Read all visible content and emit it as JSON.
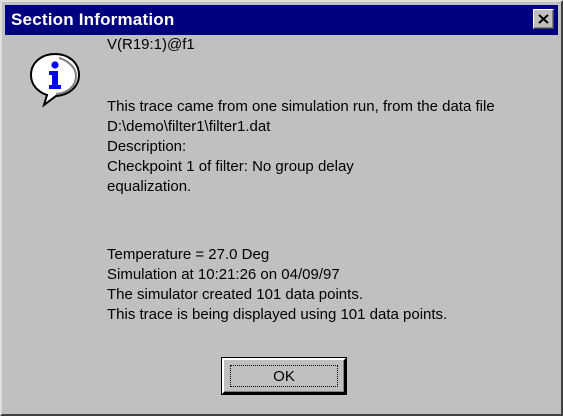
{
  "window": {
    "title": "Section Information",
    "icon": "information-icon"
  },
  "trace": {
    "name": "V(R19:1)@f1",
    "source_lines": [
      "This trace came from one simulation run, from the data file",
      "D:\\demo\\filter1\\filter1.dat",
      "Description:",
      "Checkpoint 1 of filter: No group delay",
      "equalization."
    ],
    "stats_lines": [
      "Temperature = 27.0 Deg",
      "Simulation at 10:21:26 on 04/09/97",
      "The simulator created 101 data points.",
      "This trace is being displayed using 101 data points."
    ]
  },
  "buttons": {
    "ok_label": "OK"
  }
}
